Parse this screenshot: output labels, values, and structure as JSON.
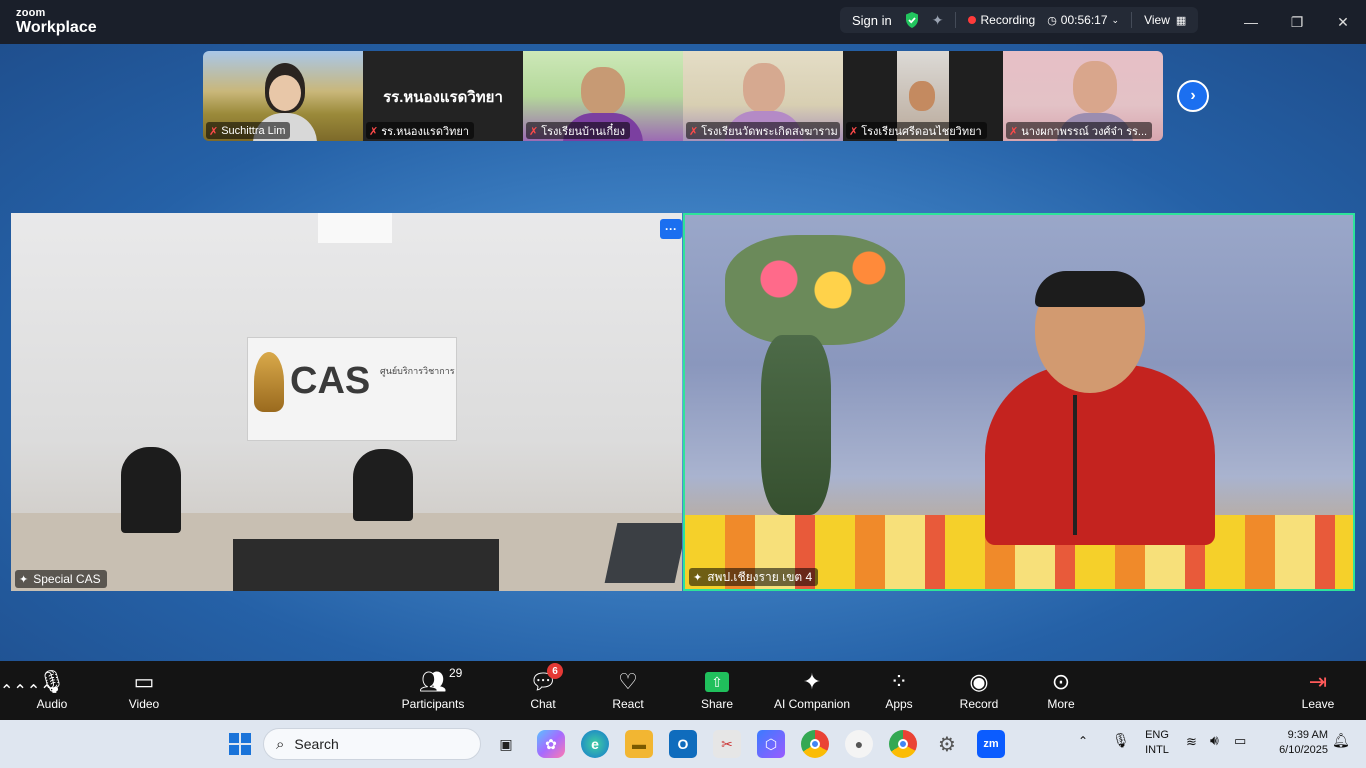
{
  "app": {
    "logo_top": "zoom",
    "logo_bottom": "Workplace",
    "sign_in": "Sign in",
    "recording": "Recording",
    "timer": "00:56:17",
    "view": "View"
  },
  "gallery": {
    "tiles": [
      {
        "name": "Suchittra Lim"
      },
      {
        "name": "รร.หนองแรดวิทยา",
        "big_label": "รร.หนองแรดวิทยา"
      },
      {
        "name": "โรงเรียนบ้านเกี๋ยง"
      },
      {
        "name": "โรงเรียนวัดพระเกิดสงฆาราม"
      },
      {
        "name": "โรงเรียนศรีดอนไชยวิทยา"
      },
      {
        "name": "นางผกาพรรณ์ วงศ์จ๋า รร..."
      }
    ]
  },
  "videos": {
    "left_name": "Special CAS",
    "left_sign": "CAS",
    "left_sign_sub": "ศูนย์บริการวิชาการ",
    "right_name": "สพป.เชียงราย เขต 4",
    "more": "···"
  },
  "toolbar": {
    "audio": "Audio",
    "video": "Video",
    "participants": "Participants",
    "participants_count": "29",
    "chat": "Chat",
    "chat_badge": "6",
    "react": "React",
    "share": "Share",
    "ai": "AI Companion",
    "apps": "Apps",
    "record": "Record",
    "more": "More",
    "leave": "Leave"
  },
  "taskbar": {
    "search_placeholder": "Search",
    "lang1": "ENG",
    "lang2": "INTL",
    "time": "9:39 AM",
    "date": "6/10/2025"
  }
}
